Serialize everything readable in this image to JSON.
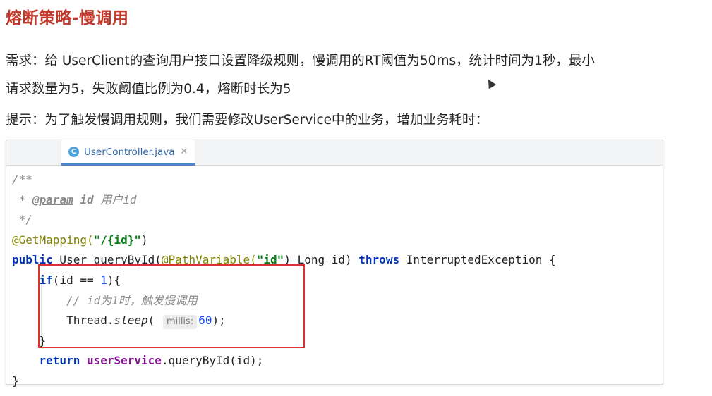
{
  "heading": "熔断策略-慢调用",
  "requirement_line1": "需求：给 UserClient的查询用户接口设置降级规则，慢调用的RT阈值为50ms，统计时间为1秒，最小",
  "requirement_line2": "请求数量为5，失败阈值比例为0.4，熔断时长为5",
  "hint": "提示：为了触发慢调用规则，我们需要修改UserService中的业务，增加业务耗时：",
  "editor": {
    "tab_label": "UserController.java",
    "tab_icon_letter": "C",
    "code": {
      "l1": "/**",
      "l2_star": " * ",
      "l2_tag": "@param",
      "l2_id": " id",
      "l2_desc": " 用户id",
      "l3": " */",
      "l4_ann": "@GetMapping(",
      "l4_str": "\"/{id}\"",
      "l4_end": ")",
      "l5_kw": "public",
      "l5_a": " User queryById(",
      "l5_ann": "@PathVariable(",
      "l5_str": "\"id\"",
      "l5_b": ") Long id) ",
      "l5_kw2": "throws",
      "l5_c": " InterruptedException {",
      "l6_kw": "if",
      "l6_a": "(id == ",
      "l6_num": "1",
      "l6_b": "){",
      "l7": "// id为1时，触发慢调用",
      "l8_a": "Thread.",
      "l8_m": "sleep",
      "l8_b": "( ",
      "l8_hint": "millis:",
      "l8_num": "60",
      "l8_c": ");",
      "l9": "}",
      "l10_kw": "return",
      "l10_fld": "userService",
      "l10_a": ".queryById(id);",
      "l11": "}"
    }
  }
}
